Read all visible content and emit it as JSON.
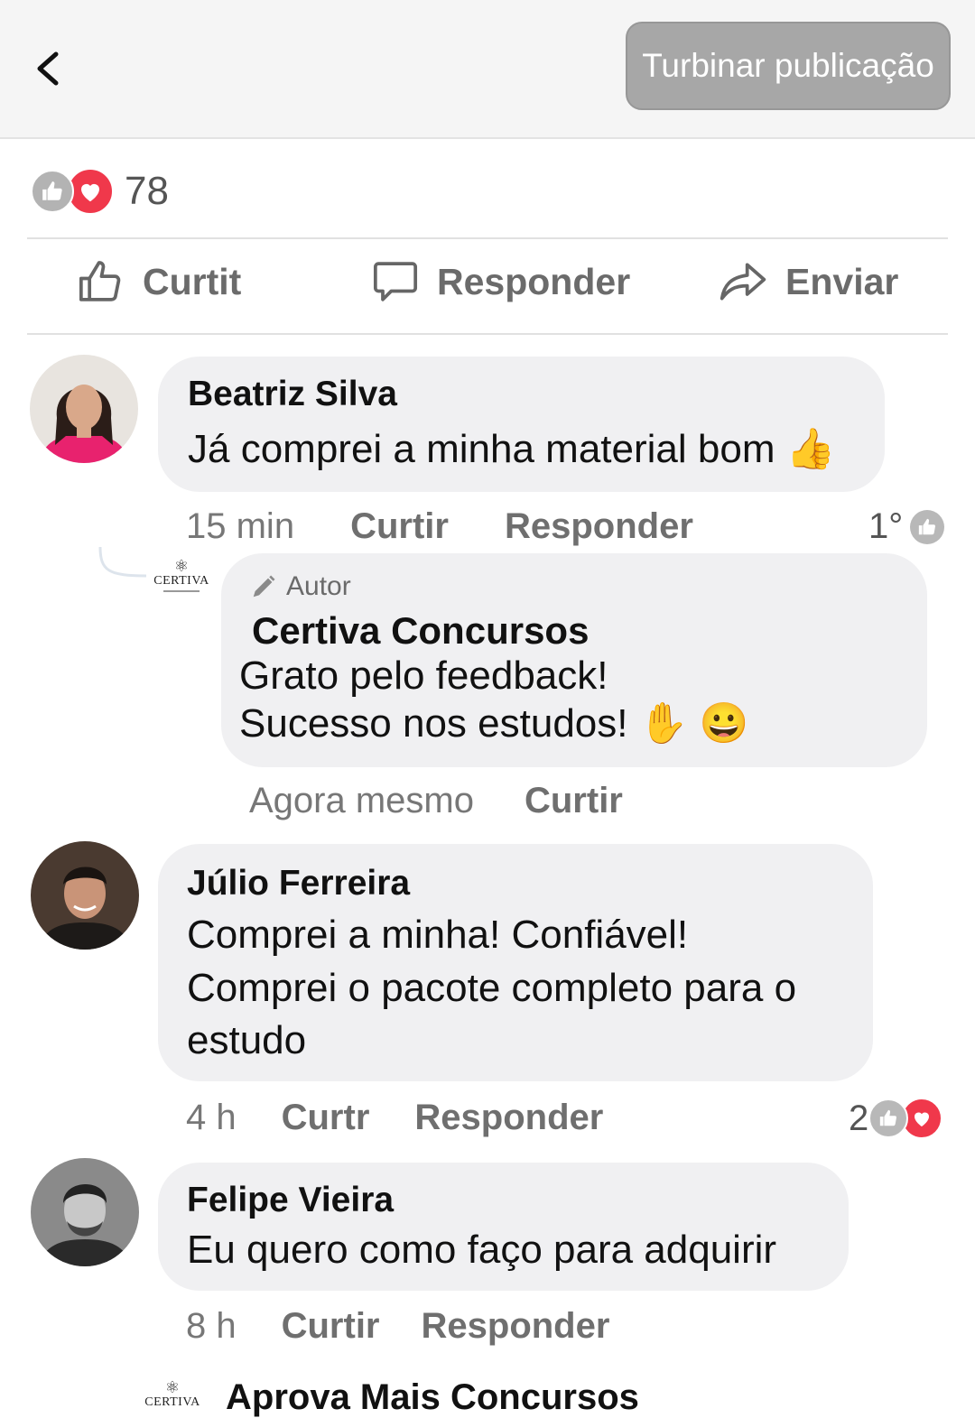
{
  "header": {
    "boost_label": "Turbinar publicação",
    "back_icon": "chevron-left-icon"
  },
  "post": {
    "reaction_count": "78"
  },
  "actions": {
    "like": "Curtit",
    "reply": "Responder",
    "share": "Enviar"
  },
  "comments": [
    {
      "name": "Beatriz Silva",
      "text": "Já comprei a minha material bom 👍",
      "time": "15 min",
      "like": "Curtir",
      "reply": "Responder",
      "badge": "1°",
      "replies": [
        {
          "author_tag": "Autor",
          "logo_text": "CERTIVA",
          "name": "Certiva Concursos",
          "line1": "Grato pelo feedback!",
          "line2": "Sucesso nos estudos! ✋ 😀",
          "time": "Agora mesmo",
          "like": "Curtir"
        }
      ]
    },
    {
      "name": "Júlio Ferreira",
      "line1": "Comprei a minha! Confiável!",
      "line2": "Comprei o pacote completo para o",
      "line3": "estudo",
      "time": "4 h",
      "like": "Curtr",
      "reply": "Responder",
      "reaction_count": "2"
    },
    {
      "name": "Felipe Vieira",
      "text": "Eu quero como faço para adquirir",
      "time": "8 h",
      "like": "Curtir",
      "reply": "Responder"
    },
    {
      "logo_text": "CERTIVA",
      "name": "Aprova Mais Concursos"
    }
  ],
  "colors": {
    "love": "#f0384b",
    "like": "#b3b3b3",
    "bubble": "#f0f0f2",
    "boost": "#a7a7a7"
  }
}
